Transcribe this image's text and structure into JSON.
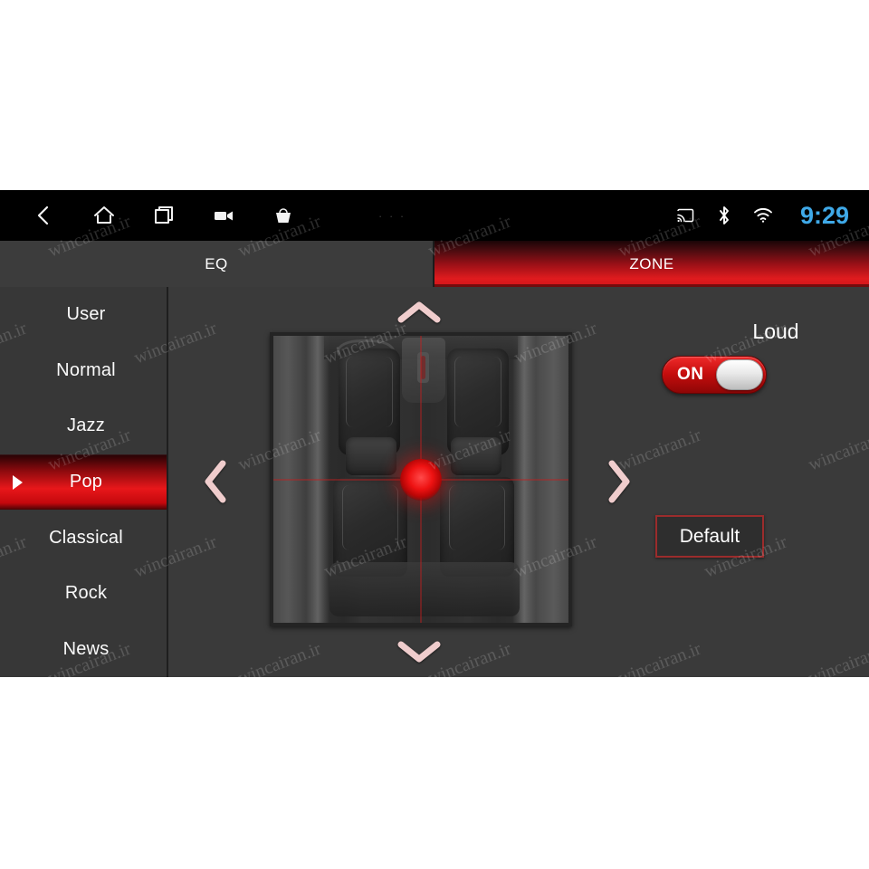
{
  "statusbar": {
    "icons": [
      {
        "name": "back-icon",
        "glyph": "chevron-left"
      },
      {
        "name": "home-icon",
        "glyph": "house"
      },
      {
        "name": "recents-icon",
        "glyph": "square-stack"
      },
      {
        "name": "video-recorder-icon",
        "glyph": "camcorder"
      },
      {
        "name": "apps-bag-icon",
        "glyph": "bag"
      }
    ],
    "overflow_dots": "· · ·",
    "cast_icon": "screen-cast-icon",
    "bluetooth_icon": "bluetooth-icon",
    "wifi_icon": "wifi-icon",
    "time": "9:29",
    "time_color": "#3fa9e8"
  },
  "tabs": [
    {
      "label": "EQ",
      "active": false
    },
    {
      "label": "ZONE",
      "active": true
    }
  ],
  "presets": {
    "items": [
      {
        "label": "User",
        "selected": false
      },
      {
        "label": "Normal",
        "selected": false
      },
      {
        "label": "Jazz",
        "selected": false
      },
      {
        "label": "Pop",
        "selected": true
      },
      {
        "label": "Classical",
        "selected": false
      },
      {
        "label": "Rock",
        "selected": false
      },
      {
        "label": "News",
        "selected": false
      }
    ]
  },
  "zone": {
    "nav_up_icon": "chevron-up-icon",
    "nav_down_icon": "chevron-down-icon",
    "nav_left_icon": "chevron-left-icon",
    "nav_right_icon": "chevron-right-icon",
    "balance_dot": "balance-position-dot",
    "image_alt": "car-interior-top-view"
  },
  "controls": {
    "loud_label": "Loud",
    "loud_state": "ON",
    "default_label": "Default"
  },
  "theme": {
    "accent_red": "#e8171a",
    "panel_bg": "#3a3a3a",
    "statusbar_bg": "#000000",
    "tab_inactive_bg": "#3c3c3c",
    "text": "#ffffff"
  },
  "watermark": {
    "text": "wincairan.ir"
  }
}
